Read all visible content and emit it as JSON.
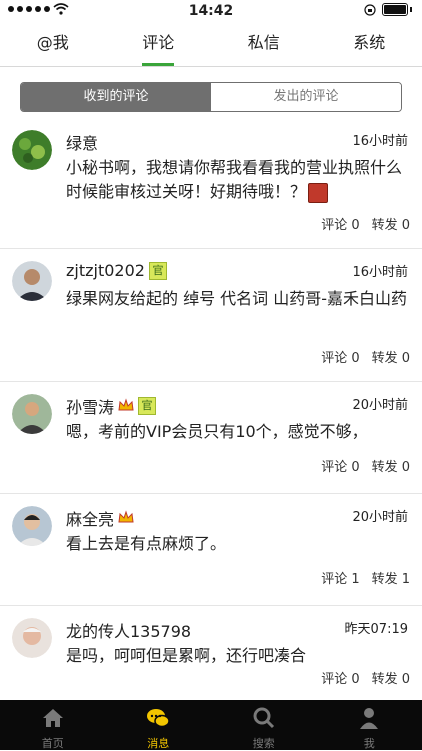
{
  "status": {
    "time": "14:42"
  },
  "tabs": [
    "@我",
    "评论",
    "私信",
    "系统"
  ],
  "segment": {
    "received": "收到的评论",
    "sent": "发出的评论"
  },
  "comments": [
    {
      "name": "绿意",
      "time": "16小时前",
      "text": "小秘书啊，我想请你帮我看看我的营业执照什么时候能审核过关呀！好期待哦！？",
      "comment": "评论 0",
      "repost": "转发 0"
    },
    {
      "name": "zjtzjt0202",
      "badge": "官",
      "time": "16小时前",
      "text": "绿果网友给起的 绰号  代名词  山药哥-嘉禾白山药",
      "comment": "评论 0",
      "repost": "转发 0"
    },
    {
      "name": "孙雪涛",
      "badge": "官",
      "time": "20小时前",
      "text": "嗯，考前的VIP会员只有10个，感觉不够，",
      "comment": "评论 0",
      "repost": "转发 0"
    },
    {
      "name": "麻全亮",
      "time": "20小时前",
      "text": "看上去是有点麻烦了。",
      "comment": "评论 1",
      "repost": "转发 1"
    },
    {
      "name": "龙的传人135798",
      "time": "昨天07:19",
      "text": "是吗，呵呵但是累啊，还行吧凑合",
      "comment": "评论 0",
      "repost": "转发 0"
    }
  ],
  "bottom_nav": [
    "首页",
    "消息",
    "搜索",
    "我"
  ]
}
